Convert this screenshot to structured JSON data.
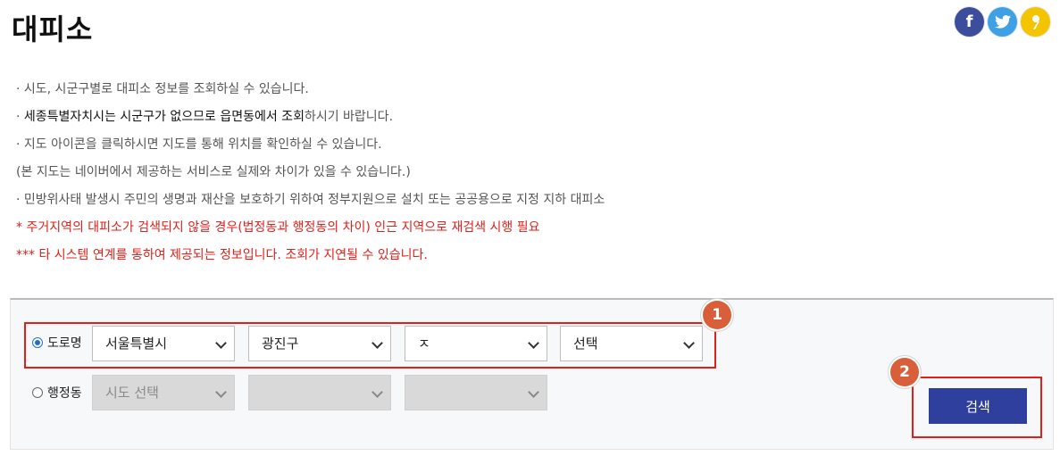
{
  "page": {
    "title": "대피소"
  },
  "social": {
    "facebook": {
      "icon": "facebook-icon",
      "glyph": "f",
      "color": "#3b4d9b"
    },
    "twitter": {
      "icon": "twitter-icon",
      "color": "#3ea0e5"
    },
    "kakao": {
      "icon": "kakaostory-icon",
      "color": "#f4c400"
    }
  },
  "info": {
    "line1": "· 시도, 시군구별로 대피소 정보를 조회하실 수 있습니다.",
    "line2_prefix": "· ",
    "line2_dark": "세종특별자치시는 시군구가 없으므로 읍면동에서 조회",
    "line2_rest": "하시기 바랍니다.",
    "line3": "· 지도 아이콘을 클릭하시면 지도를 통해 위치를 확인하실 수 있습니다.",
    "line4": "(본 지도는 네이버에서 제공하는 서비스로 실제와 차이가 있을 수 있습니다.)",
    "line5": "· 민방위사태 발생시 주민의 생명과 재산을 보호하기 위하여 정부지원으로 설치 또는 공공용으로 지정 지하 대피소",
    "line6": "* 주거지역의 대피소가 검색되지 않을 경우(법정동과 행정동의 차이) 인근 지역으로 재검색 시행 필요",
    "line7": "*** 타 시스템 연계를 통하여 제공되는 정보입니다. 조회가 지연될 수 있습니다."
  },
  "search": {
    "road": {
      "label": "도로명",
      "checked": true,
      "sido": "서울특별시",
      "sigungu": "광진구",
      "initial": "ㅈ",
      "street": "선택"
    },
    "admin": {
      "label": "행정동",
      "checked": false,
      "sido": "시도 선택",
      "sigungu": "",
      "dong": ""
    },
    "button_label": "검색"
  },
  "annotations": {
    "marker1": "1",
    "marker2": "2",
    "highlight_color": "#e0201a",
    "marker_color": "#d95f3b"
  }
}
